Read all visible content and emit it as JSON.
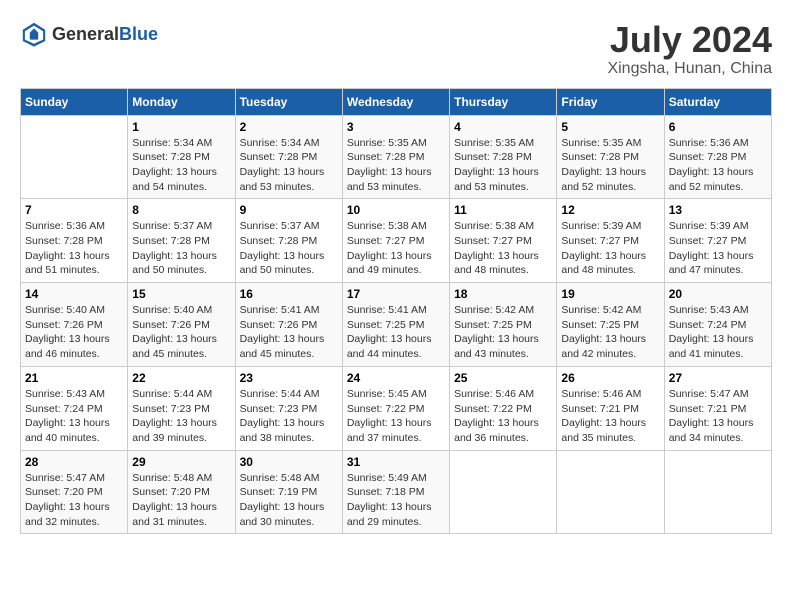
{
  "header": {
    "logo": {
      "general": "General",
      "blue": "Blue"
    },
    "title": "July 2024",
    "subtitle": "Xingsha, Hunan, China"
  },
  "columns": [
    "Sunday",
    "Monday",
    "Tuesday",
    "Wednesday",
    "Thursday",
    "Friday",
    "Saturday"
  ],
  "weeks": [
    [
      {
        "day": "",
        "info": ""
      },
      {
        "day": "1",
        "info": "Sunrise: 5:34 AM\nSunset: 7:28 PM\nDaylight: 13 hours\nand 54 minutes."
      },
      {
        "day": "2",
        "info": "Sunrise: 5:34 AM\nSunset: 7:28 PM\nDaylight: 13 hours\nand 53 minutes."
      },
      {
        "day": "3",
        "info": "Sunrise: 5:35 AM\nSunset: 7:28 PM\nDaylight: 13 hours\nand 53 minutes."
      },
      {
        "day": "4",
        "info": "Sunrise: 5:35 AM\nSunset: 7:28 PM\nDaylight: 13 hours\nand 53 minutes."
      },
      {
        "day": "5",
        "info": "Sunrise: 5:35 AM\nSunset: 7:28 PM\nDaylight: 13 hours\nand 52 minutes."
      },
      {
        "day": "6",
        "info": "Sunrise: 5:36 AM\nSunset: 7:28 PM\nDaylight: 13 hours\nand 52 minutes."
      }
    ],
    [
      {
        "day": "7",
        "info": "Sunrise: 5:36 AM\nSunset: 7:28 PM\nDaylight: 13 hours\nand 51 minutes."
      },
      {
        "day": "8",
        "info": "Sunrise: 5:37 AM\nSunset: 7:28 PM\nDaylight: 13 hours\nand 50 minutes."
      },
      {
        "day": "9",
        "info": "Sunrise: 5:37 AM\nSunset: 7:28 PM\nDaylight: 13 hours\nand 50 minutes."
      },
      {
        "day": "10",
        "info": "Sunrise: 5:38 AM\nSunset: 7:27 PM\nDaylight: 13 hours\nand 49 minutes."
      },
      {
        "day": "11",
        "info": "Sunrise: 5:38 AM\nSunset: 7:27 PM\nDaylight: 13 hours\nand 48 minutes."
      },
      {
        "day": "12",
        "info": "Sunrise: 5:39 AM\nSunset: 7:27 PM\nDaylight: 13 hours\nand 48 minutes."
      },
      {
        "day": "13",
        "info": "Sunrise: 5:39 AM\nSunset: 7:27 PM\nDaylight: 13 hours\nand 47 minutes."
      }
    ],
    [
      {
        "day": "14",
        "info": "Sunrise: 5:40 AM\nSunset: 7:26 PM\nDaylight: 13 hours\nand 46 minutes."
      },
      {
        "day": "15",
        "info": "Sunrise: 5:40 AM\nSunset: 7:26 PM\nDaylight: 13 hours\nand 45 minutes."
      },
      {
        "day": "16",
        "info": "Sunrise: 5:41 AM\nSunset: 7:26 PM\nDaylight: 13 hours\nand 45 minutes."
      },
      {
        "day": "17",
        "info": "Sunrise: 5:41 AM\nSunset: 7:25 PM\nDaylight: 13 hours\nand 44 minutes."
      },
      {
        "day": "18",
        "info": "Sunrise: 5:42 AM\nSunset: 7:25 PM\nDaylight: 13 hours\nand 43 minutes."
      },
      {
        "day": "19",
        "info": "Sunrise: 5:42 AM\nSunset: 7:25 PM\nDaylight: 13 hours\nand 42 minutes."
      },
      {
        "day": "20",
        "info": "Sunrise: 5:43 AM\nSunset: 7:24 PM\nDaylight: 13 hours\nand 41 minutes."
      }
    ],
    [
      {
        "day": "21",
        "info": "Sunrise: 5:43 AM\nSunset: 7:24 PM\nDaylight: 13 hours\nand 40 minutes."
      },
      {
        "day": "22",
        "info": "Sunrise: 5:44 AM\nSunset: 7:23 PM\nDaylight: 13 hours\nand 39 minutes."
      },
      {
        "day": "23",
        "info": "Sunrise: 5:44 AM\nSunset: 7:23 PM\nDaylight: 13 hours\nand 38 minutes."
      },
      {
        "day": "24",
        "info": "Sunrise: 5:45 AM\nSunset: 7:22 PM\nDaylight: 13 hours\nand 37 minutes."
      },
      {
        "day": "25",
        "info": "Sunrise: 5:46 AM\nSunset: 7:22 PM\nDaylight: 13 hours\nand 36 minutes."
      },
      {
        "day": "26",
        "info": "Sunrise: 5:46 AM\nSunset: 7:21 PM\nDaylight: 13 hours\nand 35 minutes."
      },
      {
        "day": "27",
        "info": "Sunrise: 5:47 AM\nSunset: 7:21 PM\nDaylight: 13 hours\nand 34 minutes."
      }
    ],
    [
      {
        "day": "28",
        "info": "Sunrise: 5:47 AM\nSunset: 7:20 PM\nDaylight: 13 hours\nand 32 minutes."
      },
      {
        "day": "29",
        "info": "Sunrise: 5:48 AM\nSunset: 7:20 PM\nDaylight: 13 hours\nand 31 minutes."
      },
      {
        "day": "30",
        "info": "Sunrise: 5:48 AM\nSunset: 7:19 PM\nDaylight: 13 hours\nand 30 minutes."
      },
      {
        "day": "31",
        "info": "Sunrise: 5:49 AM\nSunset: 7:18 PM\nDaylight: 13 hours\nand 29 minutes."
      },
      {
        "day": "",
        "info": ""
      },
      {
        "day": "",
        "info": ""
      },
      {
        "day": "",
        "info": ""
      }
    ]
  ]
}
